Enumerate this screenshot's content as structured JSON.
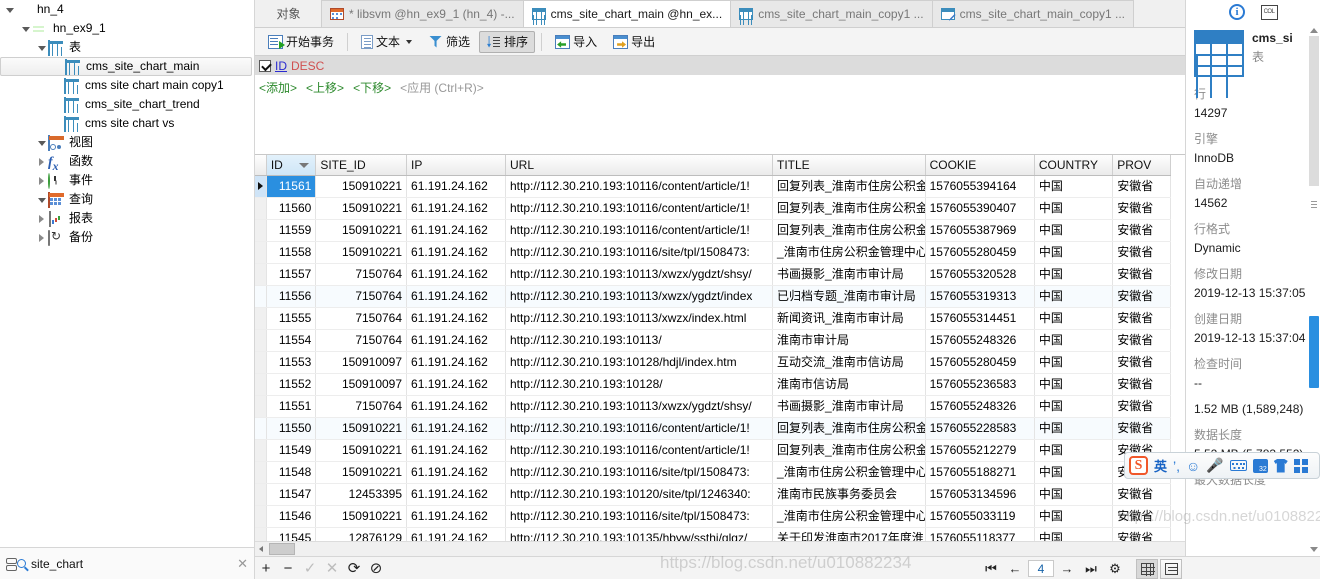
{
  "sidebar": {
    "tree": [
      {
        "label": "hn_4",
        "icon": "connection-icon",
        "indent": 0,
        "arrow": "open"
      },
      {
        "label": "hn_ex9_1",
        "icon": "database-icon",
        "indent": 1,
        "arrow": "open"
      },
      {
        "label": "表",
        "icon": "tables-folder-icon",
        "indent": 2,
        "arrow": "open"
      },
      {
        "label": "cms_site_chart_main",
        "icon": "table-icon",
        "indent": 3,
        "arrow": "none",
        "selected": true
      },
      {
        "label": "cms site chart main copy1",
        "icon": "table-icon",
        "indent": 3,
        "arrow": "none"
      },
      {
        "label": "cms_site_chart_trend",
        "icon": "table-icon",
        "indent": 3,
        "arrow": "none"
      },
      {
        "label": "cms site chart vs",
        "icon": "table-icon",
        "indent": 3,
        "arrow": "none"
      },
      {
        "label": "视图",
        "icon": "view-icon",
        "indent": 2,
        "arrow": "open"
      },
      {
        "label": "函数",
        "icon": "function-icon",
        "indent": 2,
        "arrow": "closed"
      },
      {
        "label": "事件",
        "icon": "event-icon",
        "indent": 2,
        "arrow": "closed"
      },
      {
        "label": "查询",
        "icon": "query-icon",
        "indent": 2,
        "arrow": "open"
      },
      {
        "label": "报表",
        "icon": "report-icon",
        "indent": 2,
        "arrow": "closed"
      },
      {
        "label": "备份",
        "icon": "backup-icon",
        "indent": 2,
        "arrow": "closed"
      }
    ],
    "search_value": "site_chart"
  },
  "tabs": [
    {
      "label": "对象",
      "icon": "none",
      "active": false,
      "kind": "object"
    },
    {
      "label": "* libsvm @hn_ex9_1 (hn_4) -...",
      "icon": "query-icon",
      "active": false
    },
    {
      "label": "cms_site_chart_main @hn_ex...",
      "icon": "table-icon",
      "active": true
    },
    {
      "label": "cms_site_chart_main_copy1 ...",
      "icon": "table-icon",
      "active": false
    },
    {
      "label": "cms_site_chart_main_copy1 ...",
      "icon": "table-designer-icon",
      "active": false
    }
  ],
  "toolbar": {
    "begin_transaction": "开始事务",
    "text": "文本",
    "filter": "筛选",
    "sort": "排序",
    "import": "导入",
    "export": "导出"
  },
  "sort_panel": {
    "field": "ID",
    "direction": "DESC",
    "checked": true,
    "actions": [
      "<添加>",
      "<上移>",
      "<下移>",
      "<应用 (Ctrl+R)>"
    ]
  },
  "grid": {
    "columns": [
      "ID",
      "SITE_ID",
      "IP",
      "URL",
      "TITLE",
      "COOKIE",
      "COUNTRY",
      "PROV"
    ],
    "sorted_column": "ID",
    "sort_caret": "descending",
    "rows": [
      {
        "id": "11561",
        "site_id": "150910221",
        "ip": "61.191.24.162",
        "url": "http://112.30.210.193:10116/content/article/1!",
        "title": "回复列表_淮南市住房公积金",
        "cookie": "1576055394164",
        "country": "中国",
        "prov": "安徽省"
      },
      {
        "id": "11560",
        "site_id": "150910221",
        "ip": "61.191.24.162",
        "url": "http://112.30.210.193:10116/content/article/1!",
        "title": "回复列表_淮南市住房公积金",
        "cookie": "1576055390407",
        "country": "中国",
        "prov": "安徽省"
      },
      {
        "id": "11559",
        "site_id": "150910221",
        "ip": "61.191.24.162",
        "url": "http://112.30.210.193:10116/content/article/1!",
        "title": "回复列表_淮南市住房公积金",
        "cookie": "1576055387969",
        "country": "中国",
        "prov": "安徽省"
      },
      {
        "id": "11558",
        "site_id": "150910221",
        "ip": "61.191.24.162",
        "url": "http://112.30.210.193:10116/site/tpl/1508473:",
        "title": "_淮南市住房公积金管理中心",
        "cookie": "1576055280459",
        "country": "中国",
        "prov": "安徽省"
      },
      {
        "id": "11557",
        "site_id": "7150764",
        "ip": "61.191.24.162",
        "url": "http://112.30.210.193:10113/xwzx/ygdzt/shsy/",
        "title": "书画摄影_淮南市审计局",
        "cookie": "1576055320528",
        "country": "中国",
        "prov": "安徽省"
      },
      {
        "id": "11556",
        "site_id": "7150764",
        "ip": "61.191.24.162",
        "url": "http://112.30.210.193:10113/xwzx/ygdzt/index",
        "title": "已归档专题_淮南市审计局",
        "cookie": "1576055319313",
        "country": "中国",
        "prov": "安徽省"
      },
      {
        "id": "11555",
        "site_id": "7150764",
        "ip": "61.191.24.162",
        "url": "http://112.30.210.193:10113/xwzx/index.html",
        "title": "新闻资讯_淮南市审计局",
        "cookie": "1576055314451",
        "country": "中国",
        "prov": "安徽省"
      },
      {
        "id": "11554",
        "site_id": "7150764",
        "ip": "61.191.24.162",
        "url": "http://112.30.210.193:10113/",
        "title": "淮南市审计局",
        "cookie": "1576055248326",
        "country": "中国",
        "prov": "安徽省"
      },
      {
        "id": "11553",
        "site_id": "150910097",
        "ip": "61.191.24.162",
        "url": "http://112.30.210.193:10128/hdjl/index.htm",
        "title": "互动交流_淮南市信访局",
        "cookie": "1576055280459",
        "country": "中国",
        "prov": "安徽省"
      },
      {
        "id": "11552",
        "site_id": "150910097",
        "ip": "61.191.24.162",
        "url": "http://112.30.210.193:10128/",
        "title": "淮南市信访局",
        "cookie": "1576055236583",
        "country": "中国",
        "prov": "安徽省"
      },
      {
        "id": "11551",
        "site_id": "7150764",
        "ip": "61.191.24.162",
        "url": "http://112.30.210.193:10113/xwzx/ygdzt/shsy/",
        "title": "书画摄影_淮南市审计局",
        "cookie": "1576055248326",
        "country": "中国",
        "prov": "安徽省"
      },
      {
        "id": "11550",
        "site_id": "150910221",
        "ip": "61.191.24.162",
        "url": "http://112.30.210.193:10116/content/article/1!",
        "title": "回复列表_淮南市住房公积金",
        "cookie": "1576055228583",
        "country": "中国",
        "prov": "安徽省"
      },
      {
        "id": "11549",
        "site_id": "150910221",
        "ip": "61.191.24.162",
        "url": "http://112.30.210.193:10116/content/article/1!",
        "title": "回复列表_淮南市住房公积金",
        "cookie": "1576055212279",
        "country": "中国",
        "prov": "安徽省"
      },
      {
        "id": "11548",
        "site_id": "150910221",
        "ip": "61.191.24.162",
        "url": "http://112.30.210.193:10116/site/tpl/1508473:",
        "title": "_淮南市住房公积金管理中心",
        "cookie": "1576055188271",
        "country": "中国",
        "prov": "安徽省"
      },
      {
        "id": "11547",
        "site_id": "12453395",
        "ip": "61.191.24.162",
        "url": "http://112.30.210.193:10120/site/tpl/1246340:",
        "title": "淮南市民族事务委员会",
        "cookie": "1576053134596",
        "country": "中国",
        "prov": "安徽省"
      },
      {
        "id": "11546",
        "site_id": "150910221",
        "ip": "61.191.24.162",
        "url": "http://112.30.210.193:10116/site/tpl/1508473:",
        "title": "_淮南市住房公积金管理中心",
        "cookie": "1576055033119",
        "country": "中国",
        "prov": "安徽省"
      },
      {
        "id": "11545",
        "site_id": "12876129",
        "ip": "61.191.24.162",
        "url": "http://112.30.210.193:10135/hbyw/ssthj/glgz/",
        "title": "关于印发淮南市2017年度淮",
        "cookie": "1576055118377",
        "country": "中国",
        "prov": "安徽省"
      }
    ]
  },
  "statusbar": {
    "add": "+",
    "remove": "−",
    "confirm": "✓",
    "cancel": "✕",
    "refresh": "⟳",
    "stop": "⊘",
    "page": "4",
    "first": "⏮",
    "prev": "←",
    "next": "→",
    "last": "⏭",
    "settings": "⚙"
  },
  "info_panel": {
    "table_name": "cms_si",
    "table_kind": "表",
    "props": [
      {
        "key": "行",
        "value": "14297"
      },
      {
        "key": "引擎",
        "value": "InnoDB"
      },
      {
        "key": "自动递增",
        "value": "14562"
      },
      {
        "key": "行格式",
        "value": "Dynamic"
      },
      {
        "key": "修改日期",
        "value": "2019-12-13 15:37:05"
      },
      {
        "key": "创建日期",
        "value": "2019-12-13 15:37:04"
      },
      {
        "key": "检查时间",
        "value": "--"
      },
      {
        "key": "",
        "value": "1.52 MB (1,589,248)"
      },
      {
        "key": "数据长度",
        "value": "5.52 MB (5,783,552)"
      },
      {
        "key": "最大数据长度",
        "value": ""
      }
    ]
  },
  "ime": {
    "mode": "英",
    "items": [
      "sogou-logo-icon",
      "英",
      "comma-icon",
      "emoji-icon",
      "mic-icon",
      "keyboard-icon",
      "toolbox-icon",
      "skin-icon",
      "apps-icon"
    ]
  },
  "watermark": "https://blog.csdn.net/u010882234"
}
